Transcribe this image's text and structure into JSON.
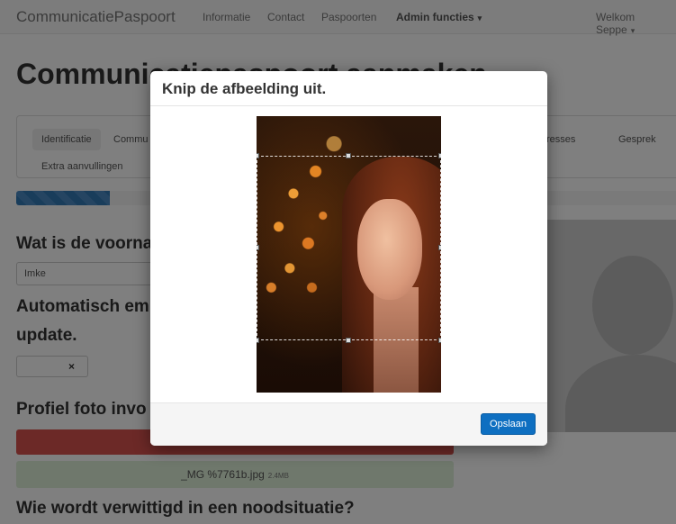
{
  "navbar": {
    "brand": "CommunicatiePaspoort",
    "links": [
      {
        "label": "Informatie"
      },
      {
        "label": "Contact"
      },
      {
        "label": "Paspoorten"
      },
      {
        "label": "Admin functies"
      }
    ],
    "user": "Welkom Seppe"
  },
  "page": {
    "title": "Communicatiepaspoort aanmaken",
    "tabs": [
      {
        "label": "Identificatie",
        "active": true
      },
      {
        "label": "Commu"
      },
      {
        "label": "resses"
      },
      {
        "label": "Gesprek"
      },
      {
        "label": "Extra aanvullingen"
      }
    ],
    "progress_fraction": 0.14,
    "q1": "Wat is de voorna",
    "q1_value": "Imke",
    "q2_line1": "Automatisch em",
    "q2_line2": "update.",
    "toggle_icon": "×",
    "q3": "Profiel foto invo",
    "file_name": "_MG %7761b.jpg",
    "file_size": "2.4MB",
    "q4": "Wie wordt verwittigd in een noodsituatie?"
  },
  "modal": {
    "title": "Knip de afbeelding uit.",
    "save_label": "Opslaan"
  },
  "colors": {
    "primary": "#0e6fc1",
    "danger": "#d9534f",
    "success_bg": "#dff0d8"
  }
}
